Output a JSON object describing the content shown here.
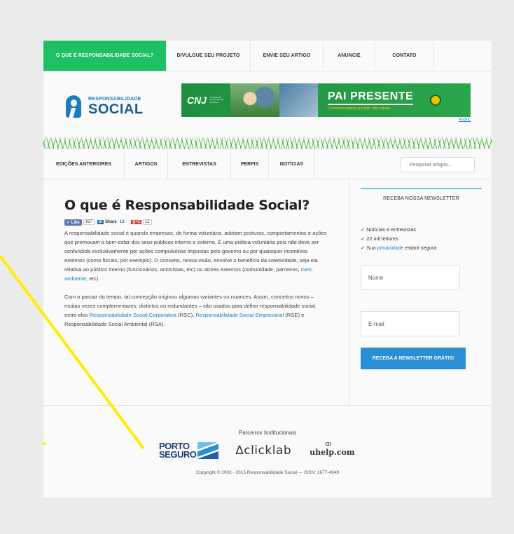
{
  "topnav": {
    "items": [
      {
        "label": "O QUE É RESPONSABILIDADE SOCIAL?",
        "active": true
      },
      {
        "label": "DIVULGUE SEU PROJETO"
      },
      {
        "label": "ENVIE SEU ARTIGO"
      },
      {
        "label": "ANUNCIE"
      },
      {
        "label": "CONTATO"
      }
    ]
  },
  "logo": {
    "line1": "RESPONSABILIDADE",
    "line2": "SOCIAL"
  },
  "banner": {
    "brand": "CNJ",
    "brand_sub": "CONSELHO NACIONAL DE JUSTIÇA",
    "title": "PAI PRESENTE",
    "subtitle": "O reconhecimento que todo filho espera.",
    "seal_caption": "PODER JUDICIÁRIO",
    "ad_link": "Anúnc"
  },
  "subnav": {
    "items": [
      "EDIÇÕES ANTERIORES",
      "ARTIGOS",
      "ENTREVISTAS",
      "PERFIS",
      "NOTÍCIAS"
    ],
    "search_placeholder": "Pesquisar artigos..."
  },
  "article": {
    "title": "O que é Responsabilidade Social?",
    "social": {
      "like": "Like",
      "like_count": "167",
      "share": "Share",
      "share_count": "13",
      "gplus": "g+1",
      "gplus_count": "12"
    },
    "p1_a": "A responsabilidade social é quando empresas, de forma voluntária, adotam posturas, comportamentos e ações que promovam o bem-estar dos seus públicos interno e externo. É uma prática voluntária pois não deve ser confundida exclusivamente por ações compulsórias impostas pelo governo ou por quaisquer incentivos externos (como fiscais, por exemplo). O conceito, nessa visão, envolve o benefício da coletividade, seja ela relativa ao público interno (funcionários, acionistas, etc) ou atores externos (comunidade, parceiros, ",
    "p1_link": "meio ambiente",
    "p1_b": ", etc).",
    "p2_a": "Com o passar do tempo, tal concepção originou algumas variantes ou nuances. Assim, conceitos novos – muitas vezes complementares, distintos ou redundantes – são usados para definir responsabilidade social, entre eles ",
    "p2_link1": "Responsabilidade Social Corporativa",
    "p2_b": " (RSC), ",
    "p2_link2": "Responsabilidade Social Empresarial",
    "p2_c": " (RSE) e Responsabilidade Social Ambiental (RSA)."
  },
  "newsletter": {
    "title": "RECEBA NOSSA NEWSLETTER",
    "items": [
      "✓ Notícias e entrevistas",
      "✓ 22 mil leitores"
    ],
    "privacy_pre": "✓ Sua ",
    "privacy_link": "privacidade",
    "privacy_post": " estará segura",
    "name_placeholder": "Nome",
    "email_placeholder": "E-mail",
    "button": "RECEBA A NEWSLETTER GRÁTIS!"
  },
  "footer": {
    "partners_title": "Parceiros Institucionais",
    "porto_line1": "PORTO",
    "porto_line2": "SEGURO",
    "clicklab": "∆clicklab",
    "uhelp": "uhelp.com",
    "uhelp_eyes": "ꝏ",
    "copyright": "Copyright © 2002 - 2015 Responsabilidade Social — ISSN: 1677-4949"
  },
  "colors": {
    "accent_green": "#1fbf65",
    "link_blue": "#1d7cc1",
    "button_blue": "#2a8ed4",
    "annotation": "#ffee00"
  }
}
